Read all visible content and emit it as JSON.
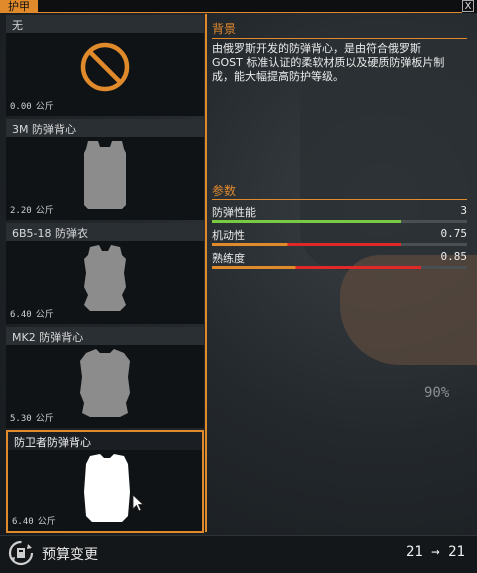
{
  "window": {
    "title": "护甲",
    "close_glyph": "X"
  },
  "armor_list": [
    {
      "name": "无",
      "weight": "0.00",
      "unit": "公斤",
      "icon": "none-prohibited-icon"
    },
    {
      "name": "3M 防弹背心",
      "weight": "2.20",
      "unit": "公斤",
      "icon": "vest-icon"
    },
    {
      "name": "6B5-18 防弹衣",
      "weight": "6.40",
      "unit": "公斤",
      "icon": "vest-icon"
    },
    {
      "name": "MK2 防弹背心",
      "weight": "5.30",
      "unit": "公斤",
      "icon": "vest-icon"
    },
    {
      "name": "防卫者防弹背心",
      "weight": "6.40",
      "unit": "公斤",
      "icon": "vest-icon",
      "selected": true
    }
  ],
  "details": {
    "background_title": "背景",
    "description": "由俄罗斯开发的防弹背心，是由符合俄罗斯\nGOST 标准认证的柔软材质以及硬质防弹板片制\n成，能大幅提高防护等级。",
    "params_title": "参数",
    "params": [
      {
        "label": "防弹性能",
        "value": "3",
        "fill": 0.74,
        "color": "#7ac943"
      },
      {
        "label": "机动性",
        "value": "0.75",
        "fill": 0.74,
        "color": "#e02828"
      },
      {
        "label": "熟练度",
        "value": "0.85",
        "fill": 0.82,
        "color": "#e02828"
      }
    ]
  },
  "overlay_percent": "90%",
  "bottom": {
    "label": "预算变更",
    "value": "21 → 21",
    "icon": "budget-icon"
  },
  "colors": {
    "accent": "#e08a2c",
    "vest_gray": "#8c8c8c",
    "vest_selected": "#ffffff"
  }
}
